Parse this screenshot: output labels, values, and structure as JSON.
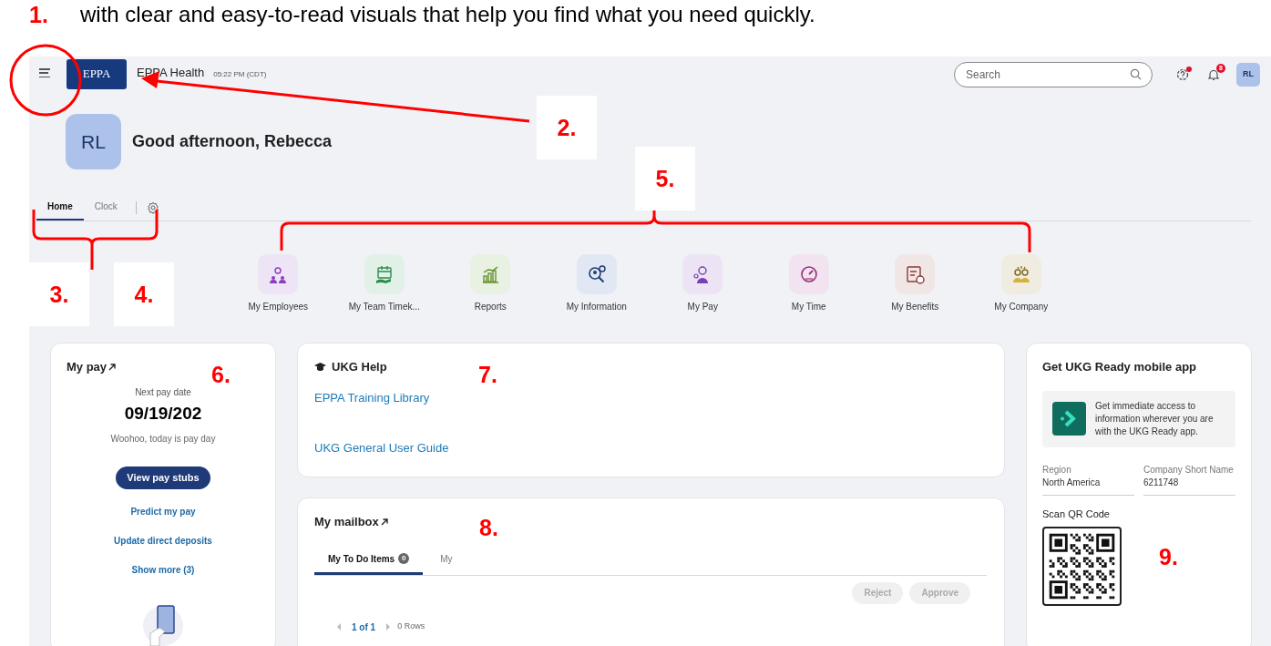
{
  "caption": "with clear and easy-to-read visuals that help you find what you need quickly.",
  "annotations": [
    {
      "label": "1."
    },
    {
      "label": "2."
    },
    {
      "label": "3."
    },
    {
      "label": "4."
    },
    {
      "label": "5."
    },
    {
      "label": "6."
    },
    {
      "label": "7."
    },
    {
      "label": "8."
    },
    {
      "label": "9."
    }
  ],
  "header": {
    "logo": "EPPA",
    "company": "EPPA Health",
    "time": "05:22 PM (CDT)",
    "search": {
      "placeholder": "Search"
    },
    "help_alert": true,
    "notification_count": "8",
    "user_initials": "RL"
  },
  "greeting": {
    "initials": "RL",
    "text": "Good afternoon, Rebecca"
  },
  "tabs": [
    {
      "label": "Home",
      "selected": true
    },
    {
      "label": "Clock",
      "selected": false
    }
  ],
  "shortcuts": [
    {
      "label": "My Employees",
      "kind": "employees",
      "color": "#ede4f5"
    },
    {
      "label": "My Team Timek...",
      "kind": "timekeeping",
      "color": "#e2f1e7"
    },
    {
      "label": "Reports",
      "kind": "reports",
      "color": "#e8f1e2"
    },
    {
      "label": "My Information",
      "kind": "information",
      "color": "#e1e8f3"
    },
    {
      "label": "My Pay",
      "kind": "pay",
      "color": "#ece4f5"
    },
    {
      "label": "My Time",
      "kind": "time",
      "color": "#f1e3f0"
    },
    {
      "label": "My Benefits",
      "kind": "benefits",
      "color": "#f1e6e6"
    },
    {
      "label": "My Company",
      "kind": "company",
      "color": "#f0ede0"
    }
  ],
  "my_pay": {
    "title": "My pay",
    "next_label": "Next pay date",
    "date": "09/19/202",
    "note": "Woohoo, today is pay day",
    "button": "View pay stubs",
    "links": [
      "Predict my pay",
      "Update direct deposits",
      "Show more (3)"
    ]
  },
  "ukg_help": {
    "title": "UKG Help",
    "links": [
      "EPPA Training Library",
      "UKG General User Guide"
    ]
  },
  "mailbox": {
    "title": "My mailbox",
    "tabs": [
      {
        "label": "My To Do Items",
        "count": "0",
        "selected": true
      },
      {
        "label": "My",
        "selected": false
      }
    ],
    "buttons": [
      {
        "label": "Reject",
        "disabled": true
      },
      {
        "label": "Approve",
        "disabled": true
      }
    ],
    "page": "1 of 1",
    "rows": "0 Rows"
  },
  "mobile_app": {
    "title": "Get UKG Ready mobile app",
    "promo": "Get immediate access to information wherever you are with the UKG Ready app.",
    "fields": [
      {
        "label": "Region",
        "value": "North America"
      },
      {
        "label": "Company Short Name",
        "value": "6211748"
      }
    ],
    "qr_label": "Scan QR Code"
  }
}
